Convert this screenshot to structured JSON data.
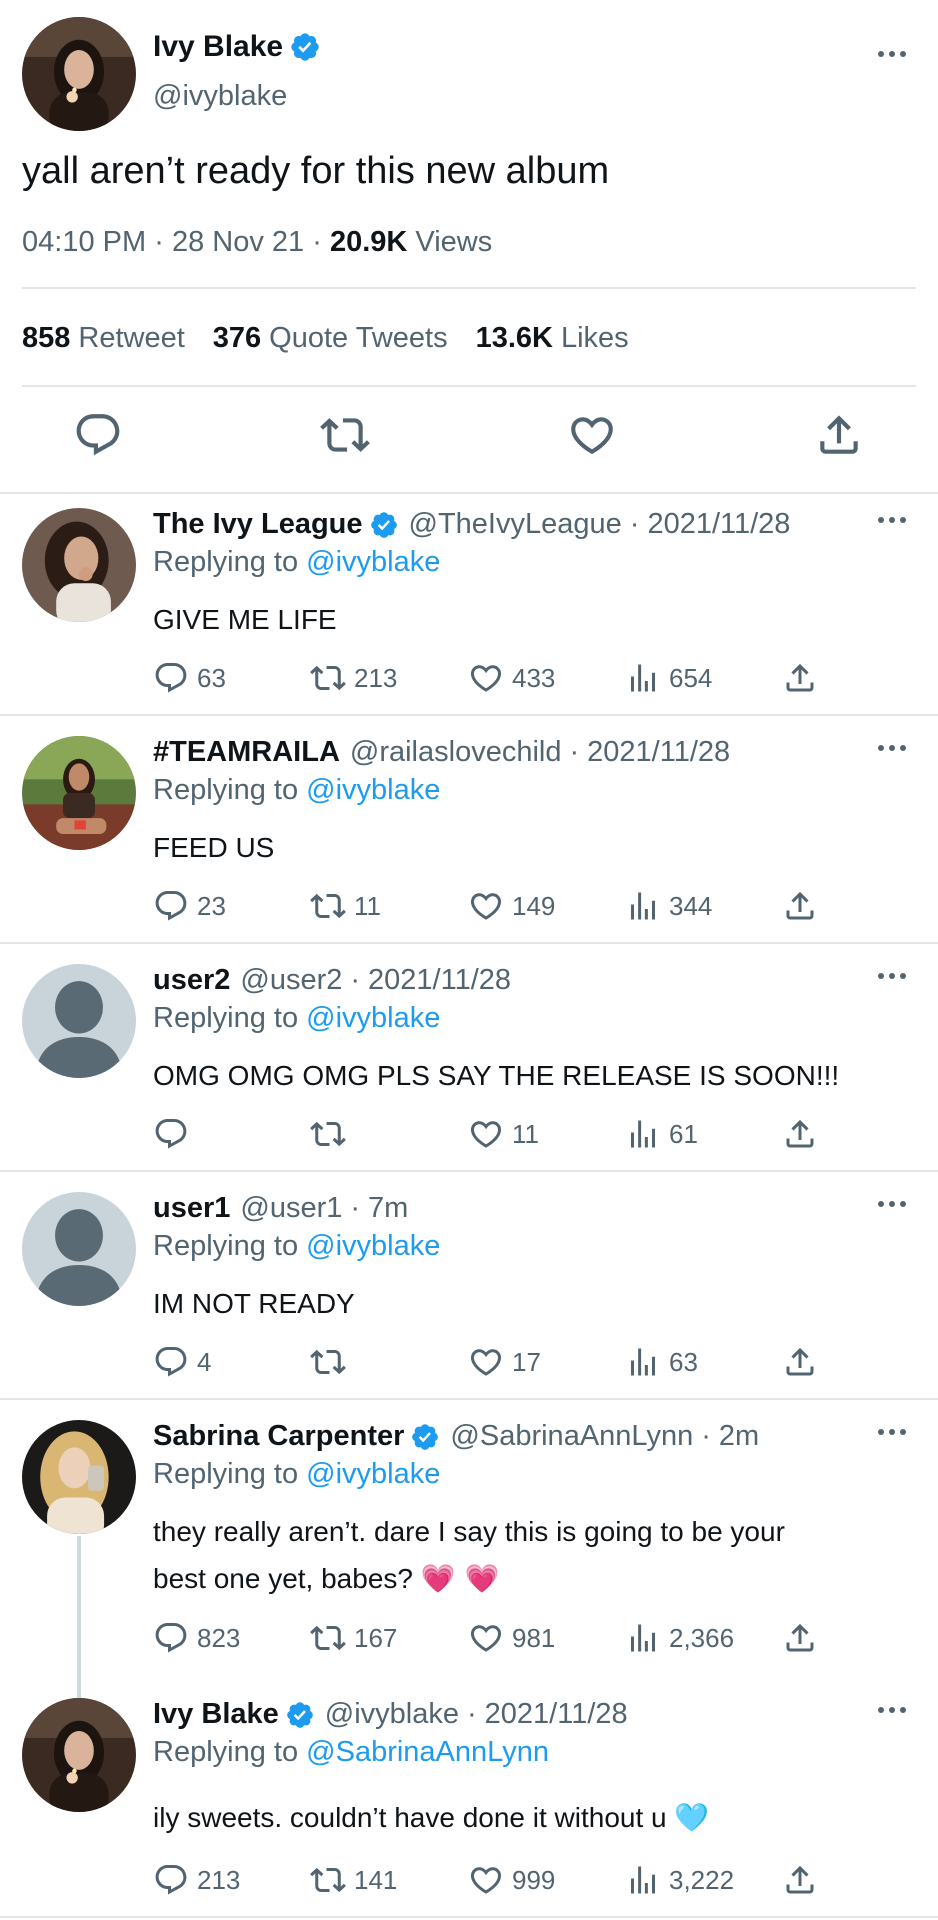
{
  "main_tweet": {
    "name": "Ivy Blake",
    "handle": "@ivyblake",
    "text": "yall aren’t ready for this new album",
    "time": "04:10 PM",
    "sep": "·",
    "date": "28 Nov 21",
    "views_count": "20.9K",
    "views_label": "Views",
    "stats": {
      "retweet_count": "858",
      "retweet_label": "Retweet",
      "quote_count": "376",
      "quote_label": "Quote Tweets",
      "likes_count": "13.6K",
      "likes_label": "Likes"
    }
  },
  "colors": {
    "accent": "#1d9bf0",
    "secondary_text": "#536471",
    "primary_text": "#0f1419",
    "divider": "#e1e6ea"
  },
  "replies": [
    {
      "name": "The Ivy League",
      "verified": true,
      "handle": "@TheIvyLeague",
      "sep": "·",
      "time": "2021/11/28",
      "replying_prefix": "Replying to",
      "replying_to": "@ivyblake",
      "text": "GIVE ME LIFE",
      "replies": "63",
      "retweets": "213",
      "likes": "433",
      "views": "654"
    },
    {
      "name": "#TEAMRAILA",
      "verified": false,
      "handle": "@railaslovechild",
      "sep": "·",
      "time": "2021/11/28",
      "replying_prefix": "Replying to",
      "replying_to": "@ivyblake",
      "text": "FEED US",
      "replies": "23",
      "retweets": "11",
      "likes": "149",
      "views": "344"
    },
    {
      "name": "user2",
      "verified": false,
      "handle": "@user2",
      "sep": "·",
      "time": "2021/11/28",
      "replying_prefix": "Replying to",
      "replying_to": "@ivyblake",
      "text": "OMG OMG OMG PLS SAY THE RELEASE IS SOON!!!",
      "replies": "",
      "retweets": "",
      "likes": "11",
      "views": "61"
    },
    {
      "name": "user1",
      "verified": false,
      "handle": "@user1",
      "sep": "·",
      "time": "7m",
      "replying_prefix": "Replying to",
      "replying_to": "@ivyblake",
      "text": "IM NOT READY",
      "replies": "4",
      "retweets": "",
      "likes": "17",
      "views": "63"
    },
    {
      "name": "Sabrina Carpenter",
      "verified": true,
      "handle": "@SabrinaAnnLynn",
      "sep": "·",
      "time": "2m",
      "replying_prefix": "Replying to",
      "replying_to": "@ivyblake",
      "text_line1": "they really aren’t. dare I say this is going to be your",
      "text_line2": "best one yet, babes?",
      "emoji": "💗 💗",
      "replies": "823",
      "retweets": "167",
      "likes": "981",
      "views": "2,366"
    },
    {
      "name": "Ivy Blake",
      "verified": true,
      "handle": "@ivyblake",
      "sep": "·",
      "time": "2021/11/28",
      "replying_prefix": "Replying to",
      "replying_to": "@SabrinaAnnLynn",
      "text": "ily sweets. couldn’t have done it without u",
      "emoji": "🩵",
      "replies": "213",
      "retweets": "141",
      "likes": "999",
      "views": "3,222"
    }
  ]
}
